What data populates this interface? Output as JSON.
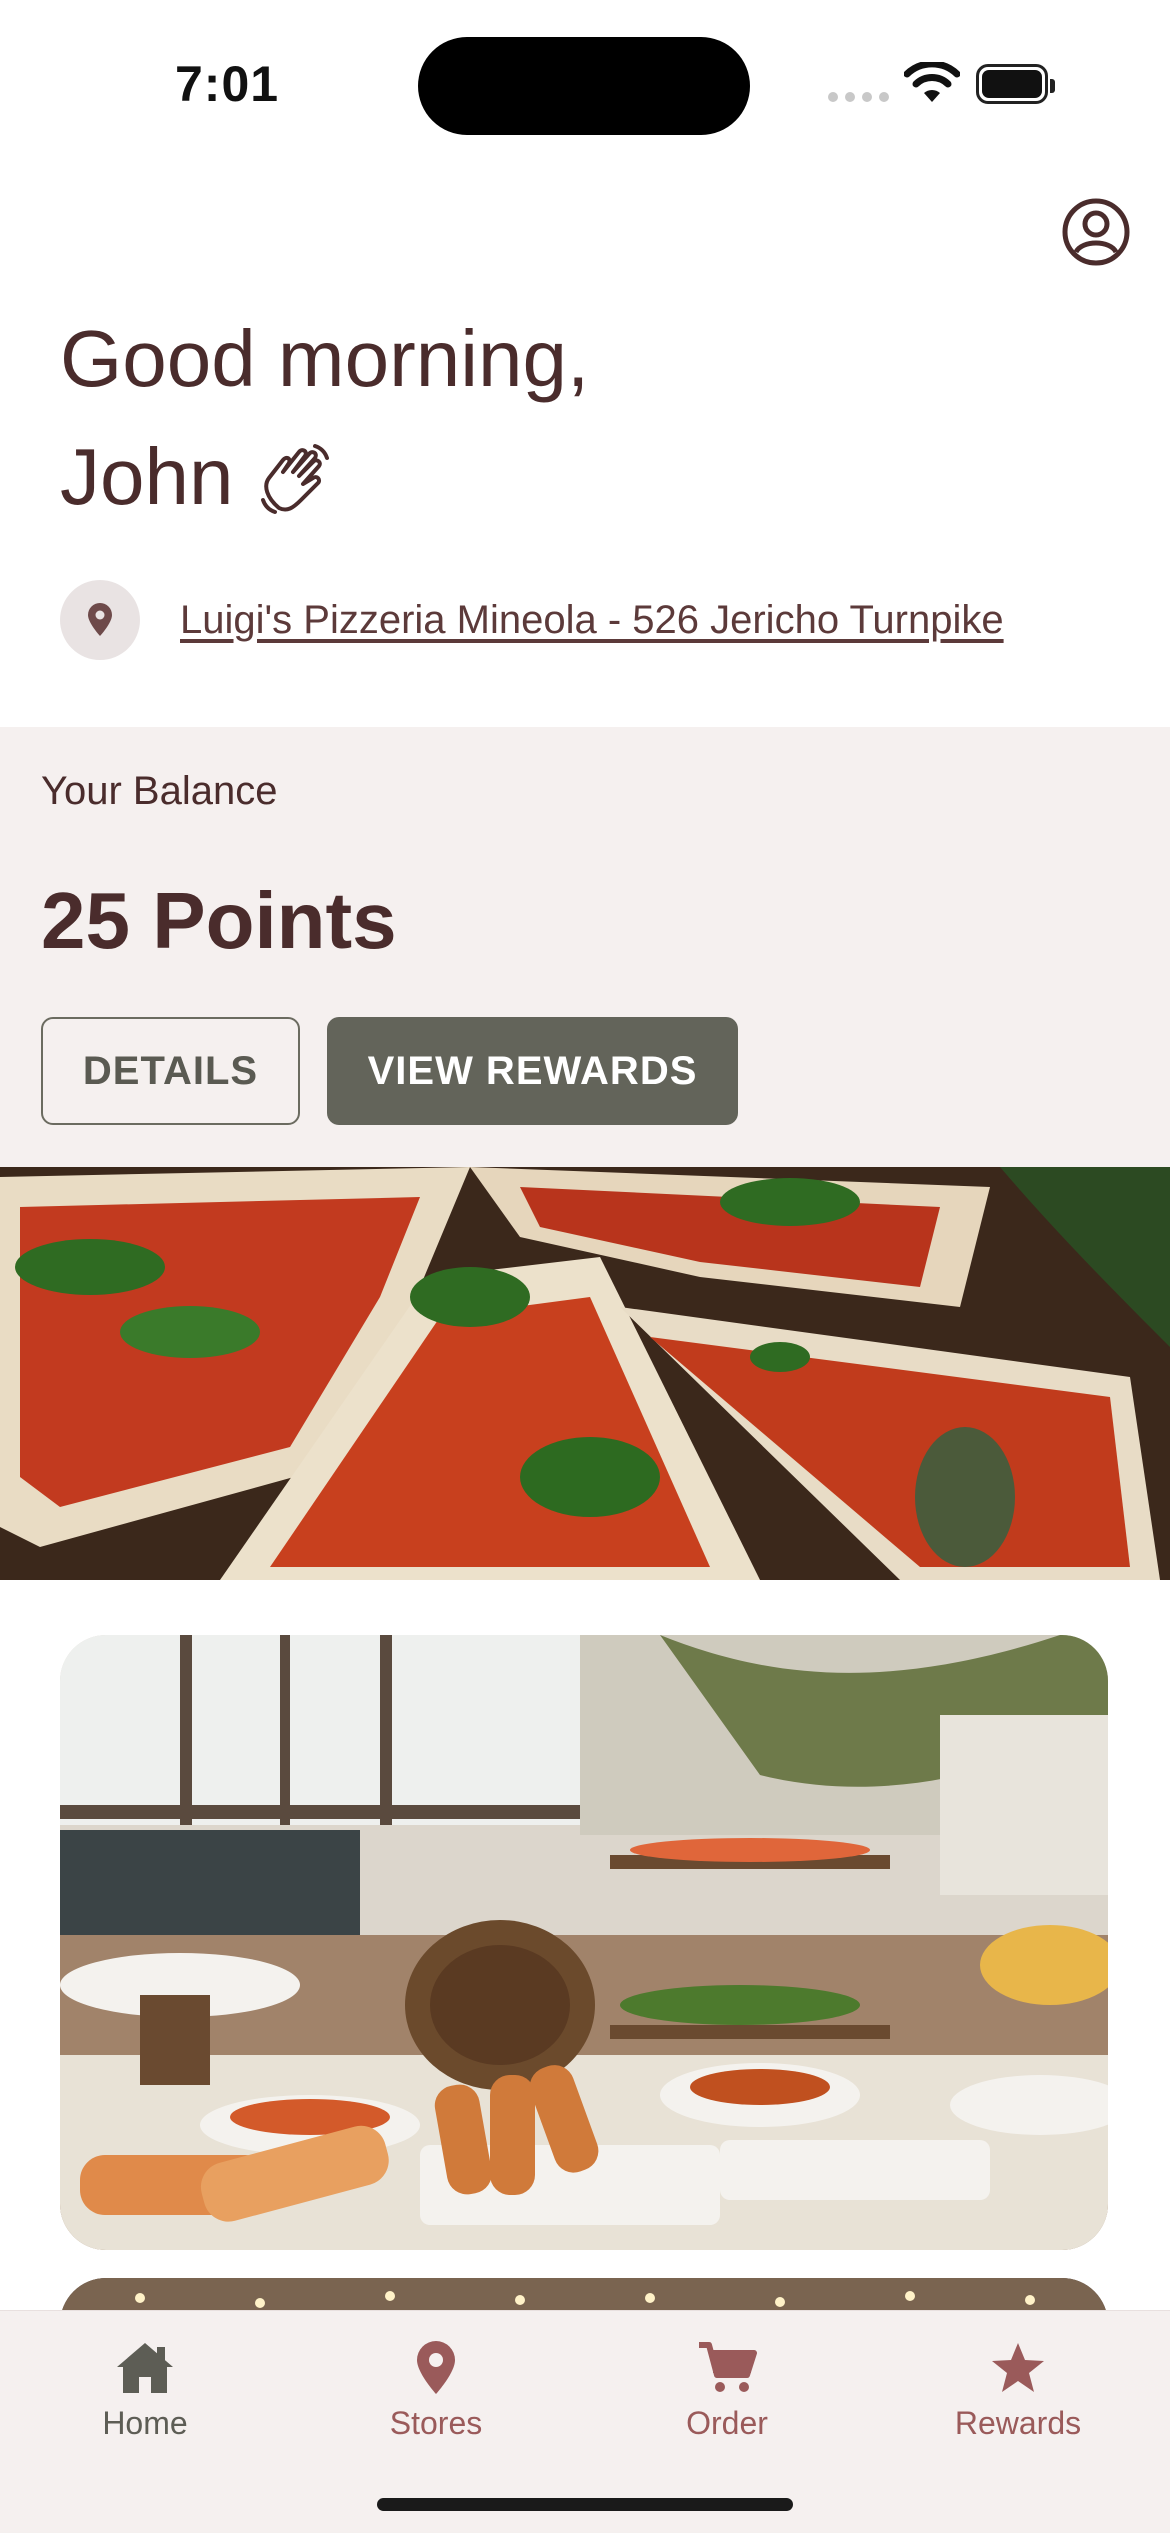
{
  "status_bar": {
    "time": "7:01"
  },
  "header": {
    "greeting_line1": "Good morning,",
    "greeting_name": "John",
    "profile_icon": "person-circle-icon",
    "wave_icon": "waving-hand-icon"
  },
  "store": {
    "icon": "map-pin-icon",
    "name": "Luigi's Pizzeria Mineola - 526 Jericho Turnpike"
  },
  "balance": {
    "label": "Your Balance",
    "points": "25 Points",
    "details_label": "DETAILS",
    "view_rewards_label": "VIEW REWARDS"
  },
  "content": {
    "hero_image": "pizza-slices-photo",
    "card_image": "restaurant-buffet-photo"
  },
  "tabbar": {
    "items": [
      {
        "label": "Home",
        "icon": "home-icon",
        "active": true
      },
      {
        "label": "Stores",
        "icon": "map-pin-icon",
        "active": false
      },
      {
        "label": "Order",
        "icon": "cart-icon",
        "active": false
      },
      {
        "label": "Rewards",
        "icon": "star-icon",
        "active": false
      }
    ]
  },
  "colors": {
    "primary_text": "#4a2c2c",
    "balance_bg": "#f5f0ef",
    "button_dark": "#63645a",
    "tab_active": "#5d5d55",
    "tab_inactive": "#9a5a5a"
  }
}
